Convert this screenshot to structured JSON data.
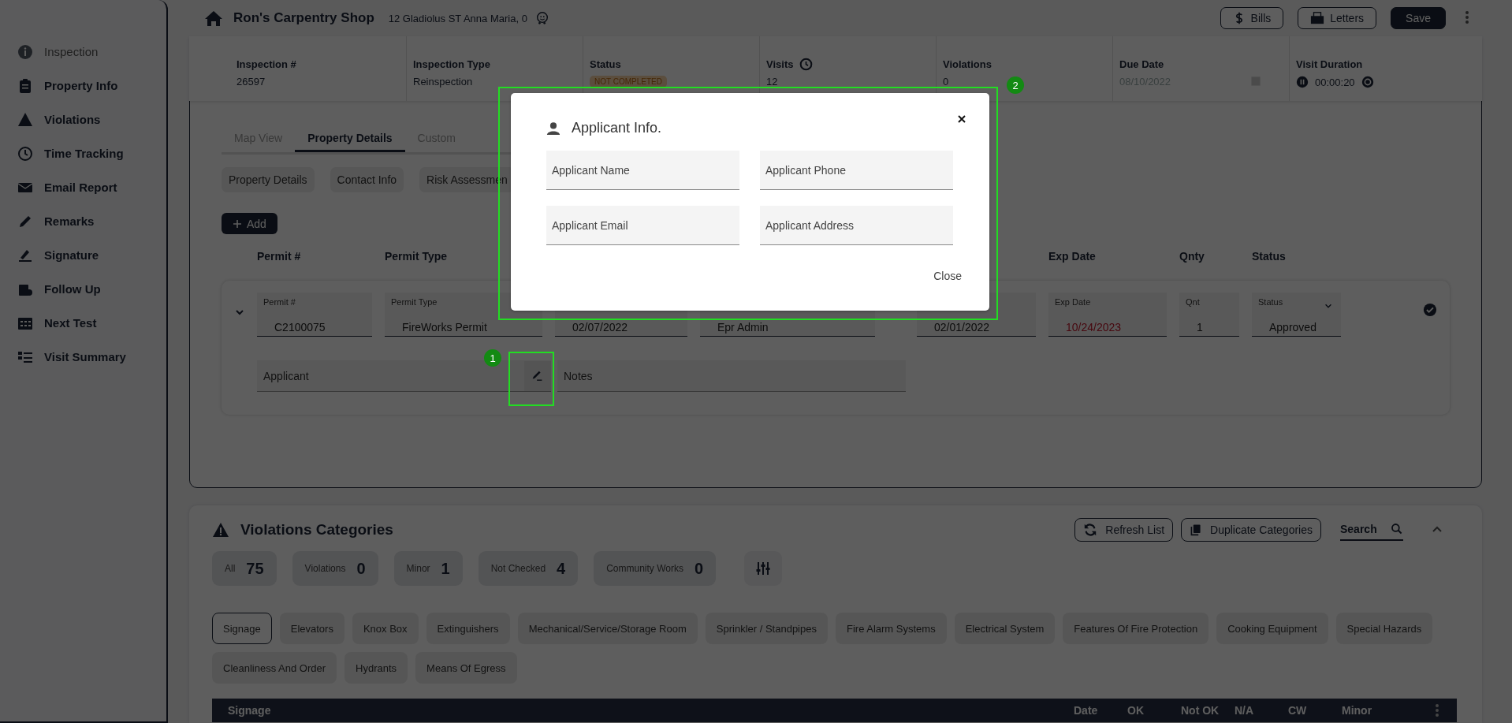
{
  "sidebar": {
    "items": [
      {
        "label": "Inspection",
        "disabled": true
      },
      {
        "label": "Property Info",
        "disabled": false
      },
      {
        "label": "Violations",
        "disabled": false
      },
      {
        "label": "Time Tracking",
        "disabled": false
      },
      {
        "label": "Email Report",
        "disabled": false
      },
      {
        "label": "Remarks",
        "disabled": false
      },
      {
        "label": "Signature",
        "disabled": false
      },
      {
        "label": "Follow Up",
        "disabled": false
      },
      {
        "label": "Next Test",
        "disabled": false
      },
      {
        "label": "Visit Summary",
        "disabled": false
      }
    ]
  },
  "header": {
    "title": "Ron's Carpentry Shop",
    "address": "12 Gladiolus ST Anna Maria, 0",
    "buttons": [
      {
        "label": "Bills",
        "kind": "bills"
      },
      {
        "label": "Letters",
        "kind": "letters"
      },
      {
        "label": "Save",
        "kind": "primary"
      }
    ]
  },
  "summary": [
    {
      "label": "Inspection #",
      "value": "26597",
      "kind": "text"
    },
    {
      "label": "Inspection Type",
      "value": "Reinspection",
      "kind": "text"
    },
    {
      "label": "Status",
      "value": "NOT COMPLETED",
      "kind": "badge"
    },
    {
      "label": "Visits",
      "value": "12",
      "kind": "history"
    },
    {
      "label": "Violations",
      "value": "0",
      "kind": "text"
    },
    {
      "label": "Due Date",
      "value": "08/10/2022",
      "kind": "date"
    },
    {
      "label": "Visit Duration",
      "value": "00:00:20",
      "kind": "timer"
    }
  ],
  "property_panel": {
    "tabs": [
      {
        "label": "Map View",
        "selected": false
      },
      {
        "label": "Property Details",
        "selected": true
      },
      {
        "label": "Custom",
        "selected": false
      }
    ],
    "chips": [
      "Property Details",
      "Contact Info",
      "Risk Assessmen"
    ],
    "add_button": "Add",
    "permit": {
      "expanded": true,
      "verified": true,
      "fields": [
        {
          "heading": "Permit #",
          "label": "Permit #",
          "value": "C2100075",
          "kind": "text",
          "overdue": false
        },
        {
          "heading": "Permit Type",
          "label": "Permit Type",
          "value": "FireWorks Permit",
          "kind": "text",
          "overdue": false
        },
        {
          "value": "02/07/2022",
          "kind": "text"
        },
        {
          "value": "Epr Admin",
          "kind": "text"
        },
        {
          "value": "02/01/2022",
          "kind": "text"
        },
        {
          "heading": "Exp Date",
          "label": "Exp Date",
          "value": "10/24/2023",
          "kind": "text",
          "overdue": true
        },
        {
          "heading": "Qnty",
          "label": "Qnt",
          "value": "1",
          "kind": "text",
          "overdue": false
        },
        {
          "heading": "Status",
          "label": "Status",
          "value": "Approved",
          "kind": "select",
          "overdue": false
        }
      ],
      "applicant": {
        "placeholder": "Applicant"
      },
      "notes": {
        "placeholder": "Notes"
      }
    }
  },
  "violations": {
    "title": "Violations Categories",
    "counters": [
      {
        "label": "All",
        "value": "75"
      },
      {
        "label": "Violations",
        "value": "0"
      },
      {
        "label": "Minor",
        "value": "1"
      },
      {
        "label": "Not Checked",
        "value": "4"
      },
      {
        "label": "Community Works",
        "value": "0"
      }
    ],
    "refresh_button": "Refresh List",
    "duplicate_button": "Duplicate Categories",
    "search": {
      "placeholder": "Search"
    },
    "categories": [
      {
        "label": "Signage",
        "selected": true
      },
      {
        "label": "Elevators",
        "selected": false
      },
      {
        "label": "Knox Box",
        "selected": false
      },
      {
        "label": "Extinguishers",
        "selected": false
      },
      {
        "label": "Mechanical/Service/Storage Room",
        "selected": false
      },
      {
        "label": "Sprinkler / Standpipes",
        "selected": false
      },
      {
        "label": "Fire Alarm Systems",
        "selected": false
      },
      {
        "label": "Electrical System",
        "selected": false
      },
      {
        "label": "Features Of Fire Protection",
        "selected": false
      },
      {
        "label": "Cooking Equipment",
        "selected": false
      },
      {
        "label": "Special Hazards",
        "selected": false
      },
      {
        "label": "Cleanliness And Order",
        "selected": false
      },
      {
        "label": "Hydrants",
        "selected": false
      },
      {
        "label": "Means Of Egress",
        "selected": false
      }
    ],
    "table": {
      "title": "Signage",
      "columns": [
        "Date",
        "OK",
        "Not OK",
        "N/A",
        "CW",
        "Minor"
      ]
    }
  },
  "modal": {
    "title": "Applicant Info.",
    "fields": [
      {
        "placeholder": "Applicant Name"
      },
      {
        "placeholder": "Applicant Phone"
      },
      {
        "placeholder": "Applicant Email"
      },
      {
        "placeholder": "Applicant Address"
      }
    ],
    "close_button": "Close"
  },
  "annotations": [
    {
      "number": "1"
    },
    {
      "number": "2"
    }
  ]
}
